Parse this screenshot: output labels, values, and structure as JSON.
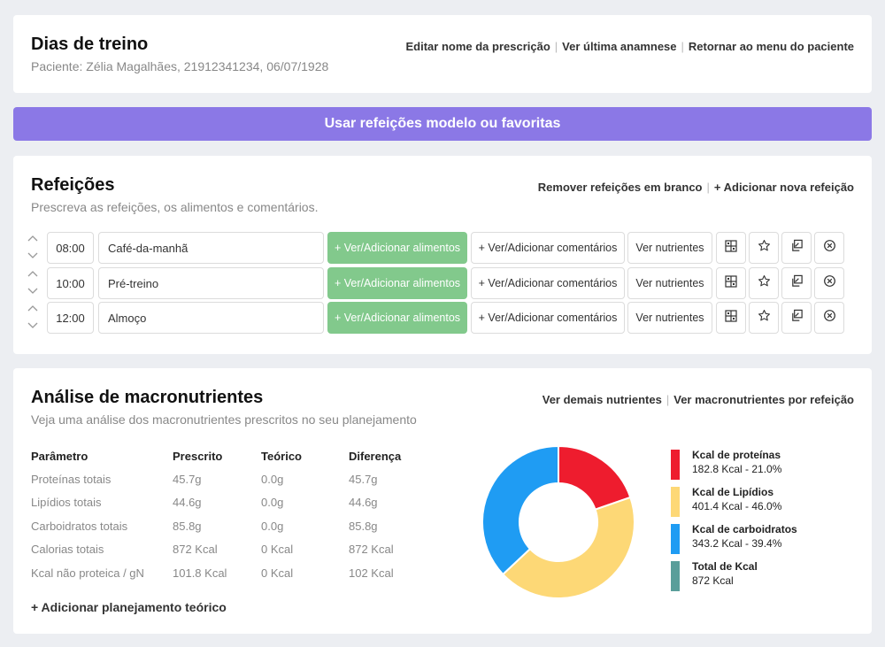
{
  "header": {
    "title": "Dias de treino",
    "patient": "Paciente: Zélia Magalhães, 21912341234, 06/07/1928",
    "links": [
      "Editar nome da prescrição",
      "Ver última anamnese",
      "Retornar ao menu do paciente"
    ]
  },
  "banner": {
    "label": "Usar refeições modelo ou favoritas"
  },
  "meals": {
    "title": "Refeições",
    "subtitle": "Prescreva as refeições, os alimentos e comentários.",
    "links": [
      "Remover refeições em branco",
      "+ Adicionar nova refeição"
    ],
    "add_foods_label": "+ Ver/Adicionar alimentos",
    "add_comments_label": "+ Ver/Adicionar comentários",
    "nutrients_label": "Ver nutrientes",
    "rows": [
      {
        "time": "08:00",
        "name": "Café-da-manhã"
      },
      {
        "time": "10:00",
        "name": "Pré-treino"
      },
      {
        "time": "12:00",
        "name": "Almoço"
      }
    ]
  },
  "macros": {
    "title": "Análise de macronutrientes",
    "subtitle": "Veja uma análise dos macronutrientes prescritos no seu planejamento",
    "links": [
      "Ver demais nutrientes",
      "Ver macronutrientes por refeição"
    ],
    "columns": [
      "Parâmetro",
      "Prescrito",
      "Teórico",
      "Diferença"
    ],
    "rows": [
      [
        "Proteínas totais",
        "45.7g",
        "0.0g",
        "45.7g"
      ],
      [
        "Lipídios totais",
        "44.6g",
        "0.0g",
        "44.6g"
      ],
      [
        "Carboidratos totais",
        "85.8g",
        "0.0g",
        "85.8g"
      ],
      [
        "Calorias totais",
        "872 Kcal",
        "0 Kcal",
        "872 Kcal"
      ],
      [
        "Kcal não proteica / gN",
        "101.8 Kcal",
        "0 Kcal",
        "102 Kcal"
      ]
    ],
    "add_plan_label": "+ Adicionar planejamento teórico",
    "legend": [
      {
        "title": "Kcal de proteínas",
        "sub": "182.8 Kcal - 21.0%",
        "color": "#ee1c2e"
      },
      {
        "title": "Kcal de Lipídios",
        "sub": "401.4 Kcal - 46.0%",
        "color": "#fdd876"
      },
      {
        "title": "Kcal de carboidratos",
        "sub": "343.2 Kcal - 39.4%",
        "color": "#1f9cf3"
      },
      {
        "title": "Total de Kcal",
        "sub": "872 Kcal",
        "color": "#5a9e9a"
      }
    ]
  },
  "chart_data": {
    "type": "pie",
    "categories": [
      "Kcal de proteínas",
      "Kcal de Lipídios",
      "Kcal de carboidratos"
    ],
    "values": [
      182.8,
      401.4,
      343.2
    ],
    "colors": [
      "#ee1c2e",
      "#fdd876",
      "#1f9cf3"
    ]
  }
}
